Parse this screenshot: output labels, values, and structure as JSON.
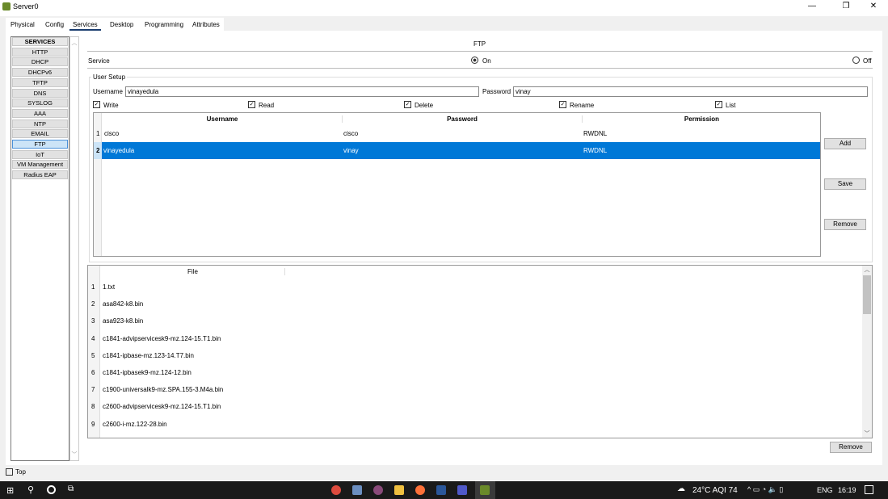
{
  "window": {
    "title": "Server0",
    "minimize": "—",
    "restore": "❐",
    "close": "✕"
  },
  "tabs": [
    "Physical",
    "Config",
    "Services",
    "Desktop",
    "Programming",
    "Attributes"
  ],
  "sidebar": {
    "header": "SERVICES",
    "items": [
      "HTTP",
      "DHCP",
      "DHCPv6",
      "TFTP",
      "DNS",
      "SYSLOG",
      "AAA",
      "NTP",
      "EMAIL",
      "FTP",
      "IoT",
      "VM Management",
      "Radius EAP"
    ],
    "selected": "FTP"
  },
  "main": {
    "title": "FTP",
    "service_label": "Service",
    "on_label": "On",
    "off_label": "Off",
    "service_state": "On",
    "user_setup": {
      "legend": "User Setup",
      "username_label": "Username",
      "username_value": "vinayedula",
      "password_label": "Password",
      "password_value": "vinay",
      "permissions": [
        {
          "label": "Write",
          "checked": true
        },
        {
          "label": "Read",
          "checked": true
        },
        {
          "label": "Delete",
          "checked": true
        },
        {
          "label": "Rename",
          "checked": true
        },
        {
          "label": "List",
          "checked": true
        }
      ],
      "columns": [
        "Username",
        "Password",
        "Permission"
      ],
      "rows": [
        {
          "n": "1",
          "username": "cisco",
          "password": "cisco",
          "permission": "RWDNL"
        },
        {
          "n": "2",
          "username": "vinayedula",
          "password": "vinay",
          "permission": "RWDNL"
        }
      ],
      "add": "Add",
      "save": "Save",
      "remove": "Remove"
    },
    "files": {
      "column": "File",
      "items": [
        {
          "n": "1",
          "name": "1.txt"
        },
        {
          "n": "2",
          "name": "asa842-k8.bin"
        },
        {
          "n": "3",
          "name": "asa923-k8.bin"
        },
        {
          "n": "4",
          "name": "c1841-advipservicesk9-mz.124-15.T1.bin"
        },
        {
          "n": "5",
          "name": "c1841-ipbase-mz.123-14.T7.bin"
        },
        {
          "n": "6",
          "name": "c1841-ipbasek9-mz.124-12.bin"
        },
        {
          "n": "7",
          "name": "c1900-universalk9-mz.SPA.155-3.M4a.bin"
        },
        {
          "n": "8",
          "name": "c2600-advipservicesk9-mz.124-15.T1.bin"
        },
        {
          "n": "9",
          "name": "c2600-i-mz.122-28.bin"
        }
      ],
      "remove": "Remove"
    }
  },
  "footer": {
    "top_label": "Top"
  },
  "taskbar": {
    "weather": "24°C AQI 74",
    "lang": "ENG",
    "time": "16:19"
  }
}
